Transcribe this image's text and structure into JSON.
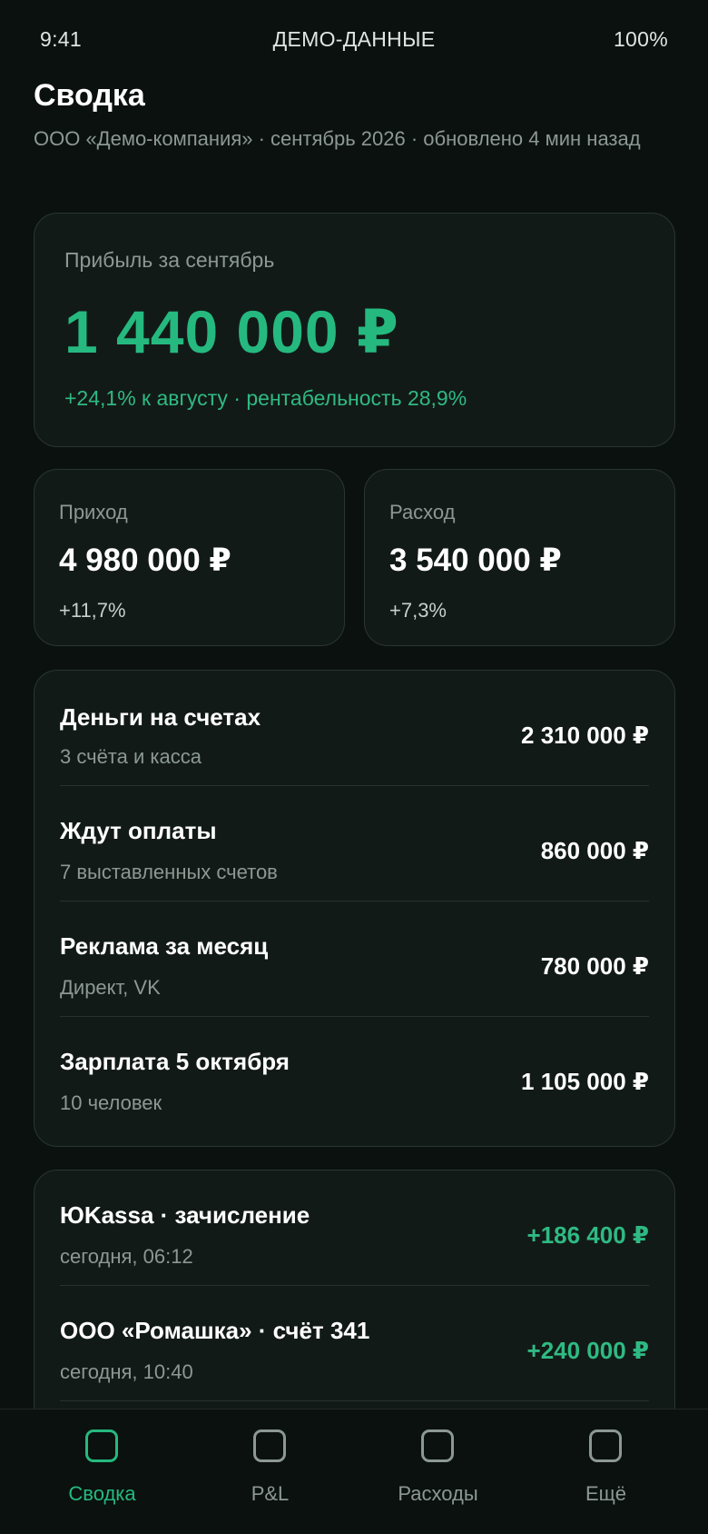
{
  "status_bar": {
    "time": "9:41",
    "center": "ДЕМО-ДАННЫЕ",
    "battery": "100%"
  },
  "header": {
    "title": "Сводка",
    "subtitle": "ООО «Демо-компания» · сентябрь 2026 · обновлено 4 мин назад"
  },
  "profit": {
    "label": "Прибыль за сентябрь",
    "value": "1 440 000 ₽",
    "delta": "+24,1% к августу · рентабельность 28,9%"
  },
  "income": {
    "label": "Приход",
    "value": "4 980 000 ₽",
    "delta": "+11,7%"
  },
  "expense": {
    "label": "Расход",
    "value": "3 540 000 ₽",
    "delta": "+7,3%"
  },
  "metrics": [
    {
      "title": "Деньги на счетах",
      "subtitle": "3 счёта и касса",
      "amount": "2 310 000 ₽"
    },
    {
      "title": "Ждут оплаты",
      "subtitle": "7 выставленных счетов",
      "amount": "860 000 ₽"
    },
    {
      "title": "Реклама за месяц",
      "subtitle": "Директ, VK",
      "amount": "780 000 ₽"
    },
    {
      "title": "Зарплата 5 октября",
      "subtitle": "10 человек",
      "amount": "1 105 000 ₽"
    }
  ],
  "transactions": [
    {
      "title": "ЮKassa · зачисление",
      "subtitle": "сегодня, 06:12",
      "amount": "+186 400 ₽"
    },
    {
      "title": "ООО «Ромашка» · счёт 341",
      "subtitle": "сегодня, 10:40",
      "amount": "+240 000 ₽"
    }
  ],
  "tabs": [
    {
      "label": "Сводка",
      "icon": "summary-icon",
      "active": true
    },
    {
      "label": "P&L",
      "icon": "pnl-icon",
      "active": false
    },
    {
      "label": "Расходы",
      "icon": "expenses-icon",
      "active": false
    },
    {
      "label": "Ещё",
      "icon": "more-icon",
      "active": false
    }
  ],
  "colors": {
    "background": "#0b110f",
    "card": "#121a17",
    "accent": "#25b97f",
    "muted": "#8c9893"
  }
}
